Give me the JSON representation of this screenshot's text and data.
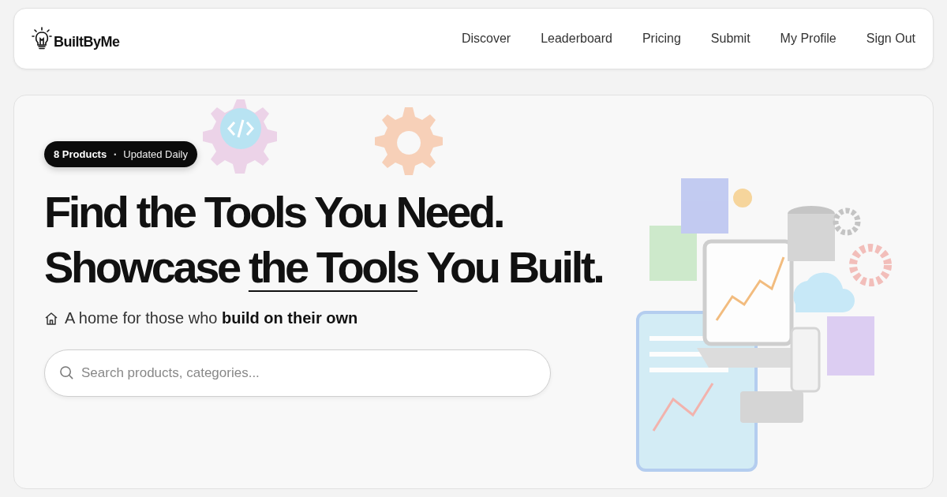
{
  "navbar": {
    "brand": "BuiltByMe",
    "links": [
      "Discover",
      "Leaderboard",
      "Pricing",
      "Submit",
      "My Profile",
      "Sign Out"
    ]
  },
  "hero": {
    "badge": {
      "count": "8 Products",
      "separator": "•",
      "note": "Updated Daily"
    },
    "headline": {
      "line_1": "Find the Tools You Need.",
      "line_2_before": "Showcase ",
      "line_2_underlined": "the Tools",
      "line_2_after": " You Built."
    },
    "subtitle": "A home for those who **build on their own**",
    "search": {
      "placeholder": "Search products, categories..."
    }
  }
}
